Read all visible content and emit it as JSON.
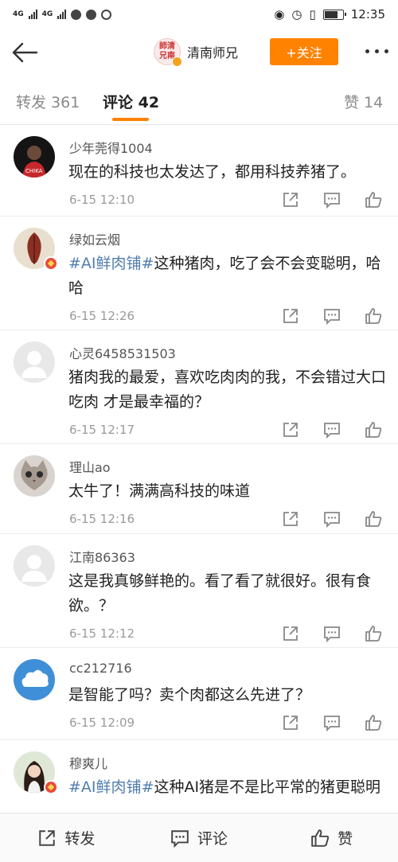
{
  "status_bar": {
    "network_1": "4G",
    "network_2": "4G",
    "time": "12:35",
    "battery_level": 0.75
  },
  "nav": {
    "user_name": "清南师兄",
    "avatar_text": "師清兄南",
    "follow_label": "+关注"
  },
  "tabs": [
    {
      "label": "转发 361"
    },
    {
      "label": "评论 42"
    },
    {
      "label": "赞 14"
    }
  ],
  "comments": [
    {
      "user": "少年莞得1004",
      "hashtag": "",
      "text": "现在的科技也太发达了，都用科技养猪了。",
      "time": "6-15 12:10",
      "avatar": "dark-portrait",
      "badge": false
    },
    {
      "user": "绿如云烟",
      "hashtag": "#AI鲜肉铺#",
      "text": "这种猪肉，吃了会不会变聪明，哈哈",
      "time": "6-15 12:26",
      "avatar": "leaf",
      "badge": true
    },
    {
      "user": "心灵6458531503",
      "hashtag": "",
      "text": "猪肉我的最爱，喜欢吃肉肉的我，不会错过大口吃肉 才是最幸福的？",
      "time": "6-15 12:17",
      "avatar": "default",
      "badge": false
    },
    {
      "user": "理山ao",
      "hashtag": "",
      "text": "太牛了！满满高科技的味道",
      "time": "6-15 12:16",
      "avatar": "cat",
      "badge": false
    },
    {
      "user": "江南86363",
      "hashtag": "",
      "text": "这是我真够鲜艳的。看了看了就很好。很有食欲。？",
      "time": "6-15 12:12",
      "avatar": "default",
      "badge": false
    },
    {
      "user": "cc212716",
      "hashtag": "",
      "text": "是智能了吗？卖个肉都这么先进了？",
      "time": "6-15 12:09",
      "avatar": "cloud",
      "badge": false
    },
    {
      "user": "穆爽儿",
      "hashtag": "#AI鲜肉铺#",
      "text": "这种AI猪是不是比平常的猪更聪明",
      "time": "",
      "avatar": "girl",
      "badge": true
    }
  ],
  "bottom_bar": {
    "repost_label": "转发",
    "comment_label": "评论",
    "like_label": "赞"
  },
  "colors": {
    "accent": "#ff8200",
    "hashtag": "#507daf"
  }
}
